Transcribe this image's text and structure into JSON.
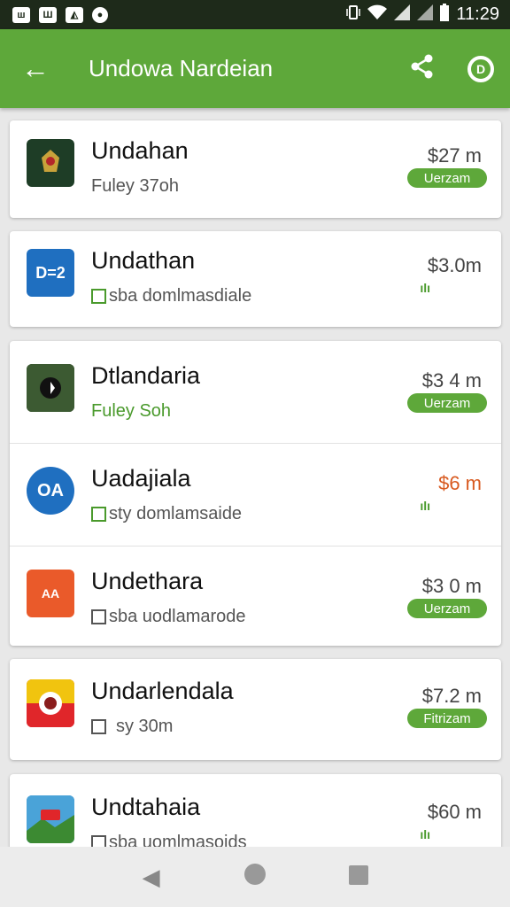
{
  "status_bar": {
    "left_icons": [
      "notification-icon",
      "gallery-icon",
      "app-icon",
      "circle-icon"
    ],
    "left_glyphs": [
      "ш",
      "Ш",
      "◭",
      "●"
    ],
    "right_icons": [
      "vibrate-icon",
      "wifi-icon",
      "signal-icon",
      "signal-icon",
      "battery-icon"
    ],
    "time": "11:29"
  },
  "app_bar": {
    "title": "Undowa Nardeian",
    "back_glyph": "←",
    "color": "#5ea83a"
  },
  "items": [
    {
      "title": "Undahan",
      "subtitle": "Fuley 37oh",
      "price": "$27 m",
      "tag": "Uerzam",
      "icon": "emblem-icon",
      "icon_text": "",
      "icon_color": "#1e3d26"
    },
    {
      "title": "Undathan",
      "subtitle": "sba domlmasdiale",
      "price": "$3.0m",
      "mini": "ılı",
      "icon": "d-icon",
      "icon_text": "D=2",
      "icon_color": "#1f6fc0"
    },
    {
      "title": "Dtlandaria",
      "subtitle": "Fuley Soh",
      "price": "$3 4 m",
      "tag": "Uerzam",
      "icon": "landscape-icon",
      "icon_text": "",
      "icon_color": "#2e3a2a"
    },
    {
      "title": "Uadajiala",
      "subtitle": "sty domlamsaide",
      "price": "$6 m",
      "mini": "ılı",
      "icon": "oa-icon",
      "icon_text": "OA",
      "icon_color": "#1f6fc0"
    },
    {
      "title": "Undethara",
      "subtitle": "sba uodlamarode",
      "price": "$3 0 m",
      "tag": "Uerzam",
      "icon": "warning-icon",
      "icon_text": "AA",
      "icon_color": "#ea5a2a"
    },
    {
      "title": "Undarlendala",
      "subtitle": "sy 30m",
      "price": "$7.2 m",
      "tag": "Fitrizam",
      "icon": "mascot-icon",
      "icon_text": "",
      "icon_color": "#e0262a"
    },
    {
      "title": "Undtahaia",
      "subtitle": "sba uomlmasoids",
      "price": "$60 m",
      "mini": "ılı",
      "icon": "photo-icon",
      "icon_text": "",
      "icon_color": "#2a7fb8"
    }
  ],
  "nav": {
    "back": "◀",
    "home": "home-icon",
    "recents": "recents-icon"
  }
}
